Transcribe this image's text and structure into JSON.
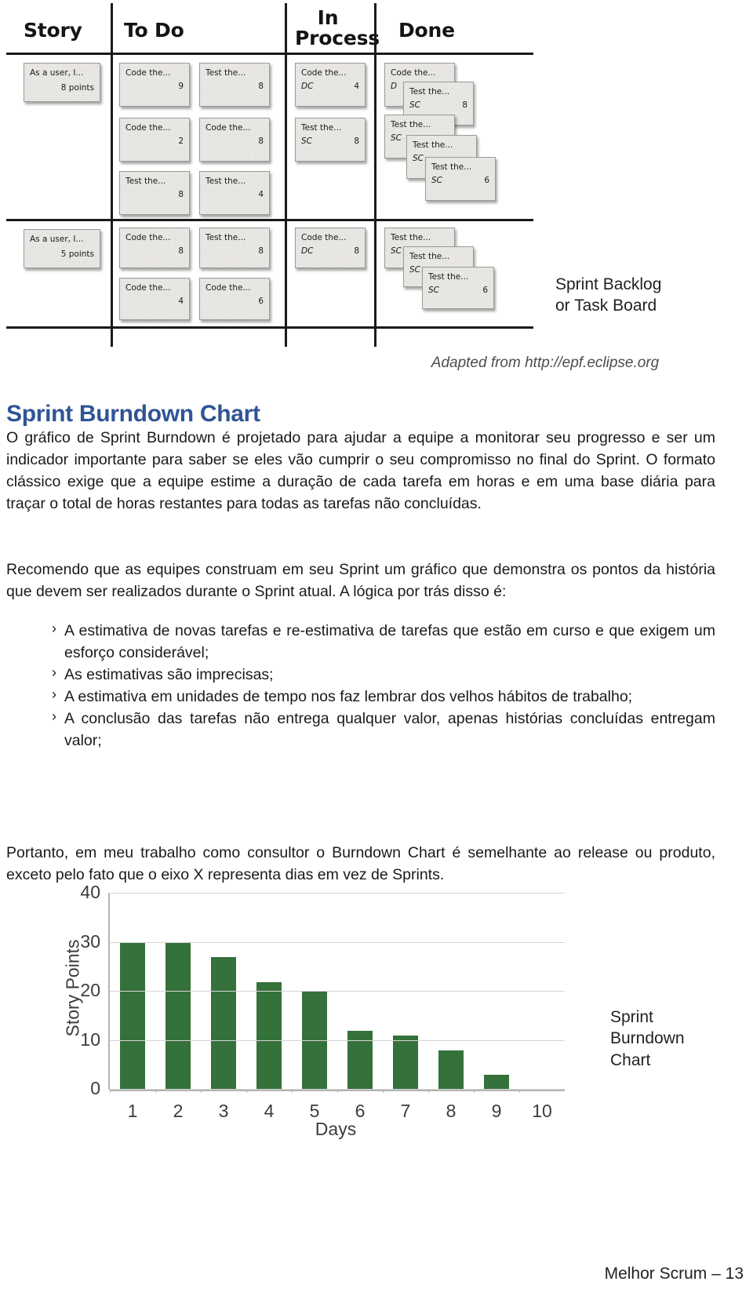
{
  "taskboard": {
    "columns": [
      "Story",
      "To Do",
      "In\nProcess",
      "Done"
    ],
    "col_story": "Story",
    "col_todo": "To Do",
    "col_inprocess_line1": "In",
    "col_inprocess_line2": "Process",
    "col_done": "Done",
    "rows": [
      {
        "story": {
          "title": "As a user, I...",
          "points": "8 points"
        },
        "todo": [
          {
            "title": "Code the...",
            "who": "",
            "num": "9"
          },
          {
            "title": "Test the...",
            "who": "",
            "num": "8"
          },
          {
            "title": "Code the...",
            "who": "",
            "num": "2"
          },
          {
            "title": "Code the...",
            "who": "",
            "num": "8"
          },
          {
            "title": "Test the...",
            "who": "",
            "num": "8"
          },
          {
            "title": "Test the...",
            "who": "",
            "num": "4"
          }
        ],
        "in_process": [
          {
            "title": "Code the...",
            "who": "DC",
            "num": "4"
          },
          {
            "title": "Test the...",
            "who": "SC",
            "num": "8"
          }
        ],
        "done": [
          {
            "title": "Code the...",
            "who": "D",
            "num": ""
          },
          {
            "title": "Test the...",
            "who": "SC",
            "num": "8"
          },
          {
            "title": "Test the...",
            "who": "SC",
            "num": ""
          },
          {
            "title": "Test the...",
            "who": "SC",
            "num": ""
          },
          {
            "title": "Test the...",
            "who": "SC",
            "num": "6"
          }
        ]
      },
      {
        "story": {
          "title": "As a user, I...",
          "points": "5 points"
        },
        "todo": [
          {
            "title": "Code the...",
            "who": "",
            "num": "8"
          },
          {
            "title": "Test the...",
            "who": "",
            "num": "8"
          },
          {
            "title": "Code the...",
            "who": "",
            "num": "4"
          },
          {
            "title": "Code the...",
            "who": "",
            "num": "6"
          }
        ],
        "in_process": [
          {
            "title": "Code the...",
            "who": "DC",
            "num": "8"
          }
        ],
        "done": [
          {
            "title": "Test the...",
            "who": "SC",
            "num": ""
          },
          {
            "title": "Test the...",
            "who": "SC",
            "num": ""
          },
          {
            "title": "Test the...",
            "who": "SC",
            "num": "6"
          }
        ]
      }
    ],
    "caption_line1": "Sprint Backlog",
    "caption_line2": "or Task Board",
    "source_note": "Adapted from http://epf.eclipse.org"
  },
  "section": {
    "heading": "Sprint Burndown Chart",
    "paragraph_1": "O gráfico de Sprint Burndown é projetado para ajudar a equipe a monitorar seu progresso e ser um indicador importante para saber se eles vão cumprir o seu compromisso no final do Sprint. O formato clássico exige que a equipe estime a duração de cada tarefa em horas e em uma base diária para traçar o total de horas restantes para todas as tarefas não concluídas.",
    "paragraph_2": "Recomendo que as equipes construam em seu Sprint um gráfico que demonstra os pontos da história que devem ser realizados durante o Sprint atual. A lógica por trás disso é:",
    "bullets": [
      "A estimativa de novas tarefas e re-estimativa de tarefas que estão em curso e que exigem um esforço considerável;",
      "As estimativas são imprecisas;",
      "A estimativa em unidades de tempo nos faz lembrar dos velhos hábitos de trabalho;",
      "A conclusão das tarefas não entrega qualquer valor, apenas histórias concluídas entregam valor;"
    ],
    "paragraph_3": "Portanto, em meu trabalho como consultor o Burndown Chart é semelhante ao release ou produto, exceto pelo fato que o eixo X representa dias em vez de Sprints."
  },
  "chart_caption": {
    "line1": "Sprint",
    "line2": "Burndown",
    "line3": "Chart"
  },
  "chart_data": {
    "type": "bar",
    "title": "",
    "xlabel": "Days",
    "ylabel": "Story Points",
    "categories": [
      "1",
      "2",
      "3",
      "4",
      "5",
      "6",
      "7",
      "8",
      "9",
      "10"
    ],
    "values": [
      30,
      30,
      27,
      22,
      20,
      12,
      11,
      8,
      3,
      0
    ],
    "ylim": [
      0,
      40
    ],
    "yticks": [
      "0",
      "10",
      "20",
      "30",
      "40"
    ],
    "ytick_values": [
      0,
      10,
      20,
      30,
      40
    ],
    "grid": true,
    "legend": "none",
    "bar_color": "#35713a"
  },
  "footer": {
    "text": "Melhor Scrum – 13"
  }
}
